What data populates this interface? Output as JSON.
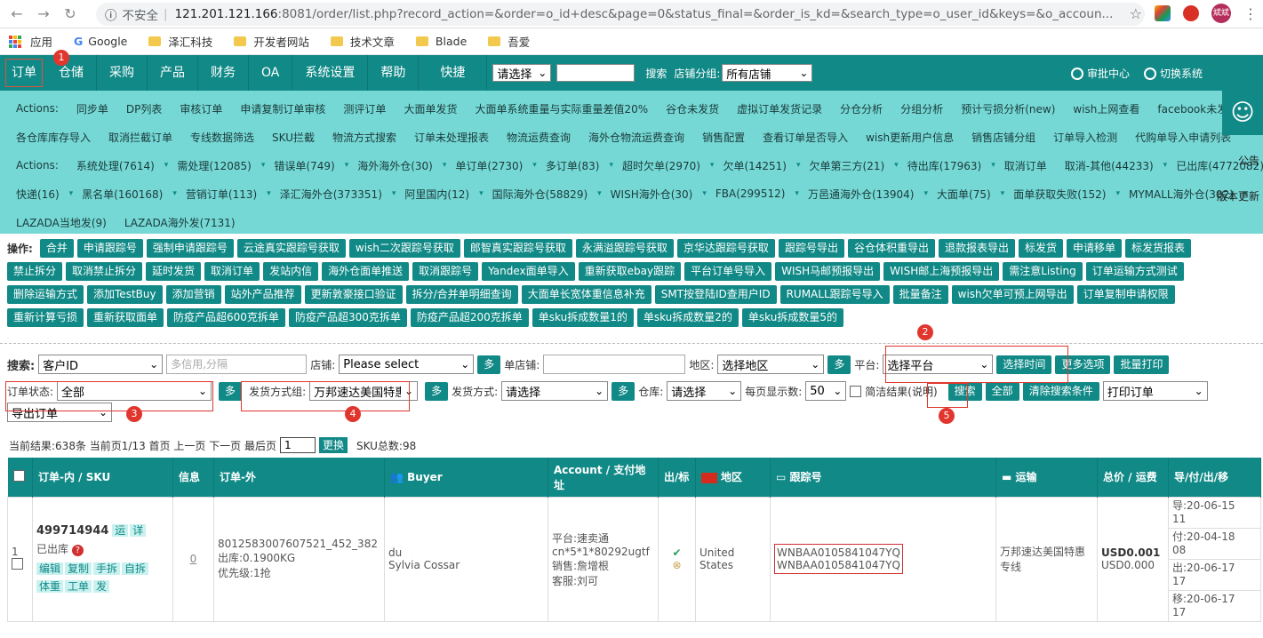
{
  "browser": {
    "insecure": "不安全",
    "host": "121.201.121.166",
    "rest": ":8081/order/list.php?record_action=&order=o_id+desc&page=0&status_final=&order_is_kd=&search_type=o_user_id&keys=&o_accoun...",
    "avatar": "斌斌"
  },
  "bookmarks": [
    "应用",
    "Google",
    "泽汇科技",
    "开发者网站",
    "技术文章",
    "Blade",
    "吾爱"
  ],
  "nav": {
    "items": [
      "订单",
      "仓储",
      "采购",
      "产品",
      "财务",
      "OA",
      "系统设置",
      "帮助",
      "快捷"
    ],
    "select1": "请选择",
    "search": "搜索",
    "store_group_label": "店铺分组:",
    "store_group": "所有店铺",
    "approve": "审批中心",
    "switch": "切换系统"
  },
  "badges": [
    "1",
    "2",
    "3",
    "4",
    "5"
  ],
  "actions": {
    "row1": [
      "Actions:",
      "同步单",
      "DP列表",
      "审核订单",
      "申请复制订单审核",
      "测评订单",
      "大面单发货",
      "大面单系统重量与实际重量差值20%",
      "谷仓未发货",
      "虚拟订单发货记录",
      "分仓分析",
      "分组分析",
      "预计亏损分析(new)",
      "wish上网查看",
      "facebook未发"
    ],
    "row2": [
      "各仓库库存导入",
      "取消拦截订单",
      "专线数据筛选",
      "SKU拦截",
      "物流方式搜索",
      "订单未处理报表",
      "物流运费查询",
      "海外仓物流运费查询",
      "销售配置",
      "查看订单是否导入",
      "wish更新用户信息",
      "销售店铺分组",
      "订单导入检测",
      "代购单导入申请列表"
    ],
    "row3": [
      "Actions:",
      "系统处理(7614)",
      "需处理(12085)",
      "错误单(749)",
      "海外海外仓(30)",
      "单订单(2730)",
      "多订单(83)",
      "超时欠单(2970)",
      "欠单(14251)",
      "欠单第三方(21)",
      "待出库(17963)",
      "取消订单",
      "取消-其他(44233)",
      "已出库(4772082)"
    ],
    "row4": [
      "快递(16)",
      "黑名单(160168)",
      "营销订单(113)",
      "泽汇海外仓(373351)",
      "阿里国内(12)",
      "国际海外仓(58829)",
      "WISH海外仓(30)",
      "FBA(299512)",
      "万邑通海外仓(13904)",
      "大面单(75)",
      "面单获取失败(152)",
      "MYMALL海外仓(302)"
    ],
    "row5": [
      "LAZADA当地发(9)",
      "LAZADA海外发(7131)"
    ],
    "side1": "公告",
    "side2": "版本更新"
  },
  "ops": {
    "label": "操作:",
    "row1": [
      "合并",
      "申请跟踪号",
      "强制申请跟踪号",
      "云途真实跟踪号获取",
      "wish二次跟踪号获取",
      "郎智真实跟踪号获取",
      "永满溢跟踪号获取",
      "京华达跟踪号获取",
      "跟踪号导出",
      "谷仓体积重导出",
      "退款报表导出",
      "标发货",
      "申请移单",
      "标发货报表"
    ],
    "row2": [
      "禁止拆分",
      "取消禁止拆分",
      "延时发货",
      "取消订单",
      "发站内信",
      "海外仓面单推送",
      "取消跟踪号",
      "Yandex面单导入",
      "重新获取ebay跟踪",
      "平台订单号导入",
      "WISH马邮预报导出",
      "WISH邮上海预报导出",
      "需注意Listing",
      "订单运输方式测试"
    ],
    "row3": [
      "删除运输方式",
      "添加TestBuy",
      "添加营销",
      "站外产品推荐",
      "更新敦豪接口验证",
      "拆分/合并单明细查询",
      "大面单长宽体重信息补充",
      "SMT按登陆ID查用户ID",
      "RUMALL跟踪号导入",
      "批量备注",
      "wish欠单可预上网导出",
      "订单复制申请权限"
    ],
    "row4": [
      "重新计算亏损",
      "重新获取面单",
      "防疫产品超600克拆单",
      "防疫产品超300克拆单",
      "防疫产品超200克拆单",
      "单sku拆成数量1的",
      "单sku拆成数量2的",
      "单sku拆成数量5的"
    ]
  },
  "search": {
    "label": "搜索:",
    "type": "客户ID",
    "placeholder": "多信用,分隔",
    "store": "店铺:",
    "store_val": "Please select",
    "more": "多",
    "single_store": "单店铺:",
    "region": "地区:",
    "region_val": "选择地区",
    "platform": "平台:",
    "platform_val": "选择平台",
    "select_time": "选择时间",
    "more_opts": "更多选项",
    "batch_print": "批量打印",
    "status_label": "订单状态:",
    "status_val": "全部",
    "ship_group": "发货方式组:",
    "ship_group_val": "万邦速达美国特惠",
    "ship_method": "发货方式:",
    "ship_method_val": "请选择",
    "warehouse": "仓库:",
    "warehouse_val": "请选择",
    "per_page": "每页显示数:",
    "per_page_val": "50",
    "brief": "简洁结果(说明)",
    "search_btn": "搜索",
    "all": "全部",
    "clear": "清除搜索条件",
    "print": "打印订单",
    "export": "导出订单"
  },
  "pager": {
    "text1": "当前结果:638条 当前页1/13 首页 上一页 下一页 最后页",
    "page": "1",
    "go": "更换",
    "sku": "SKU总数:98"
  },
  "table": {
    "headers": [
      "订单-内 / SKU",
      "信息",
      "订单-外",
      "Buyer",
      "Account / 支付地址",
      "出/标",
      "地区",
      "跟踪号",
      "运输",
      "总价 / 运费",
      "导/付/出/移"
    ],
    "row": {
      "idx": "1",
      "order_id": "499714944",
      "t1": "运",
      "t2": "详",
      "status": "已出库",
      "actions": [
        "编辑",
        "复制",
        "手拆",
        "自拆",
        "体重",
        "工单",
        "发"
      ],
      "info": "0",
      "ext1": "8012583007607521_452_382",
      "ext2": "出库:0.1900KG",
      "ext3": "优先级:1抢",
      "buyer1": "du",
      "buyer2": "Sylvia Cossar",
      "acc1": "平台:速卖通",
      "acc2": "cn*5*1*80292ugtf",
      "acc3": "销售:詹增根",
      "acc4": "客服:刘可",
      "region1": "United",
      "region2": "States",
      "track1": "WNBAA0105841047YQ",
      "track2": "WNBAA0105841047YQ",
      "ship1": "万邦速达美国特惠",
      "ship2": "专线",
      "price1": "USD0.001",
      "price2": "USD0.000",
      "d1": "导:20-06-15",
      "d1b": "11",
      "d2": "付:20-04-18",
      "d2b": "08",
      "d3": "出:20-06-17",
      "d3b": "17",
      "d4": "移:20-06-17",
      "d4b": "17"
    }
  }
}
